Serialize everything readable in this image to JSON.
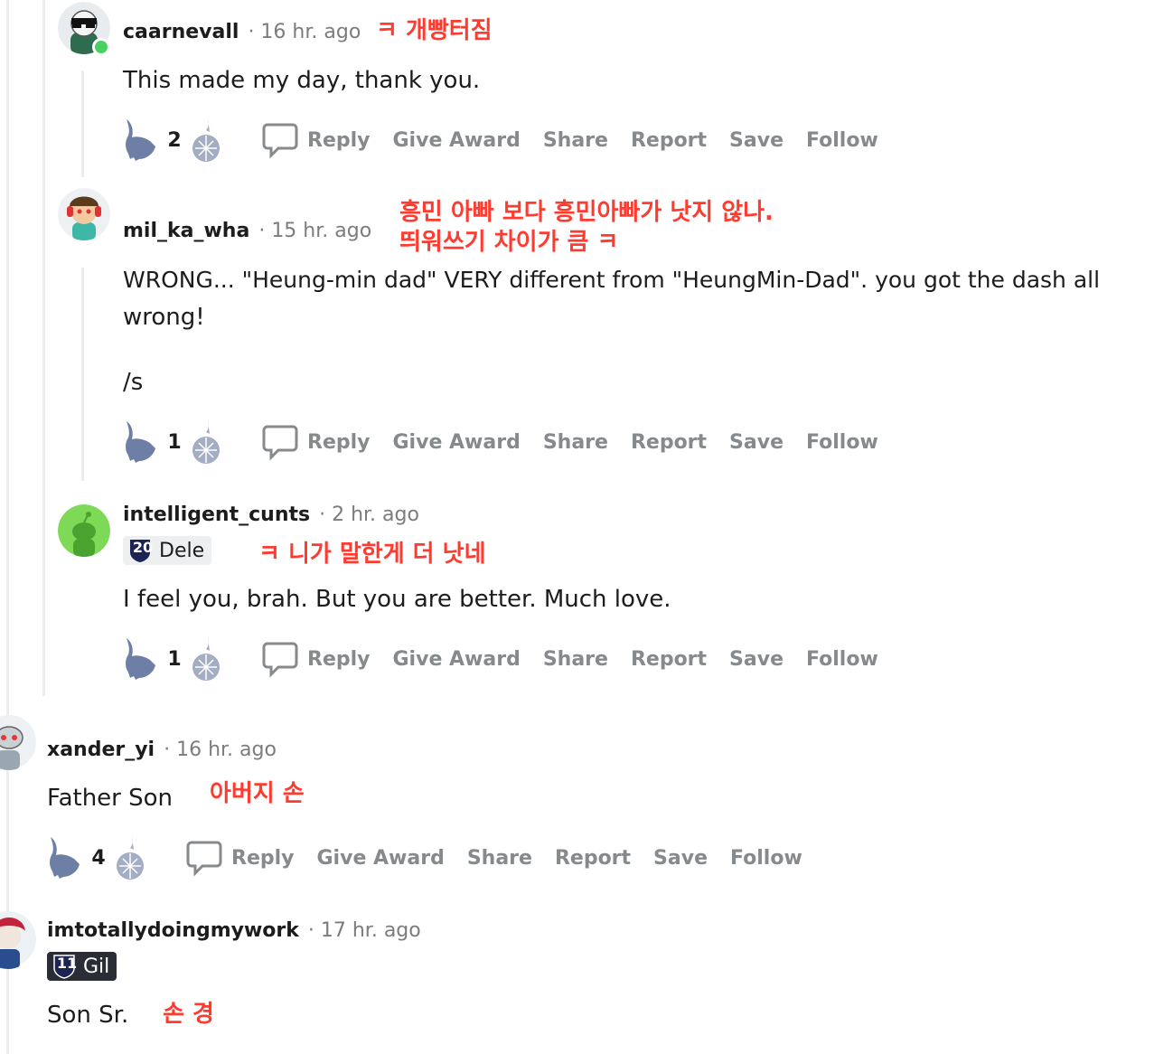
{
  "actions": {
    "reply": "Reply",
    "give_award": "Give Award",
    "share": "Share",
    "report": "Report",
    "save": "Save",
    "follow": "Follow"
  },
  "comments": [
    {
      "username": "caarnevall",
      "time": "· 16 hr. ago",
      "body": [
        "This made my day, thank you."
      ],
      "score": "2",
      "annotation": [
        "ㅋ 개빵터짐"
      ],
      "avatar": "sunglasses-avatar-icon"
    },
    {
      "username": "mil_ka_wha",
      "time": "· 15 hr. ago",
      "body": [
        "WRONG... \"Heung-min dad\" VERY different from \"HeungMin-Dad\". you got the dash all",
        "wrong!",
        "/s"
      ],
      "score": "1",
      "annotation": [
        "흥민 아빠 보다 흥민아빠가 낫지 않나.",
        "띄워쓰기 차이가 큼 ㅋ"
      ],
      "avatar": "headphones-avatar-icon"
    },
    {
      "username": "intelligent_cunts",
      "time": "· 2 hr. ago",
      "flair": {
        "number": "20",
        "name": "Dele"
      },
      "body": [
        "I feel you, brah. But you are better. Much love."
      ],
      "score": "1",
      "annotation": [
        "ㅋ 니가 말한게 더 낫네"
      ],
      "avatar": "default-snoo-avatar-icon"
    },
    {
      "username": "xander_yi",
      "time": "· 16 hr. ago",
      "body": [
        "Father Son"
      ],
      "score": "4",
      "annotation": [
        "아버지 손"
      ],
      "avatar": "robot-snoo-avatar-icon"
    },
    {
      "username": "imtotallydoingmywork",
      "time": "· 17 hr. ago",
      "flair": {
        "number": "11",
        "name": "Gil"
      },
      "body": [
        "Son Sr."
      ],
      "annotation": [
        "손 경"
      ],
      "avatar": "red-hair-avatar-icon"
    }
  ],
  "colors": {
    "annotation": "#ff3b30",
    "action_gray": "#878a8c",
    "meta_gray": "#7c7c7c",
    "thread_line": "#ededed",
    "vote_blue": "#6e7fa6",
    "flair_dark": "#2a2c36",
    "flair_light": "#edeff1"
  }
}
